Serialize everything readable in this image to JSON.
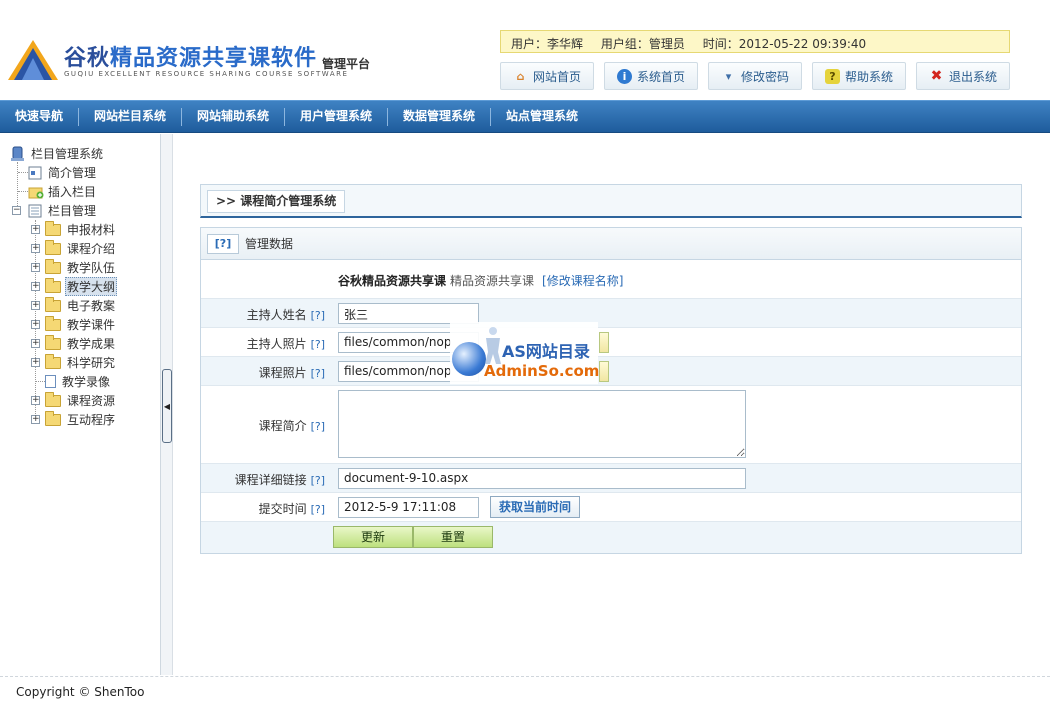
{
  "header": {
    "logo_title_a": "谷秋",
    "logo_title_b": "精品资源共享课软件",
    "logo_subtitle": "GUQIU EXCELLENT RESOURCE SHARING COURSE SOFTWARE",
    "logo_platform": "管理平台",
    "user_label": "用户：李华辉",
    "group_label": "用户组：管理员",
    "time_label": "时间：2012-05-22 09:39:40",
    "buttons": [
      {
        "label": "网站首页",
        "icon": "home-icon"
      },
      {
        "label": "系统首页",
        "icon": "info-icon"
      },
      {
        "label": "修改密码",
        "icon": "pin-icon"
      },
      {
        "label": "帮助系统",
        "icon": "help-icon"
      },
      {
        "label": "退出系统",
        "icon": "close-icon"
      }
    ]
  },
  "nav": {
    "items": [
      "快速导航",
      "网站栏目系统",
      "网站辅助系统",
      "用户管理系统",
      "数据管理系统",
      "站点管理系统"
    ]
  },
  "sidebar": {
    "root": "栏目管理系统",
    "intro": "简介管理",
    "insert": "插入栏目",
    "column": "栏目管理",
    "items": [
      "申报材料",
      "课程介绍",
      "教学队伍",
      "教学大纲",
      "电子教案",
      "教学课件",
      "教学成果",
      "科学研究",
      "教学录像",
      "课程资源",
      "互动程序"
    ],
    "selected": "教学大纲"
  },
  "content": {
    "title": ">> 课程简介管理系统",
    "panel_qm": "[?]",
    "panel_title": "管理数据",
    "course_name_bold": "谷秋精品资源共享课",
    "course_name_plain": "精品资源共享课",
    "course_name_link": "[修改课程名称]",
    "help_mark": "[?]",
    "fields": {
      "host_name_label": "主持人姓名",
      "host_name_value": "张三",
      "host_photo_label": "主持人照片",
      "host_photo_value": "files/common/nop",
      "course_photo_label": "课程照片",
      "course_photo_value": "files/common/nop",
      "course_intro_label": "课程简介",
      "course_link_label": "课程详细链接",
      "course_link_value": "document-9-10.aspx",
      "submit_time_label": "提交时间",
      "submit_time_value": "2012-5-9 17:11:08",
      "get_time_button": "获取当前时间"
    },
    "update_button": "更新",
    "reset_button": "重置"
  },
  "watermark": {
    "line1": "AS网站目录",
    "line2": "AdminSo.com"
  },
  "footer": {
    "copyright": "Copyright © ShenToo"
  },
  "colors": {
    "nav_blue": "#2a6bb5",
    "userbar_yellow": "#fdf7c7",
    "panel_border": "#c6d6e3"
  }
}
